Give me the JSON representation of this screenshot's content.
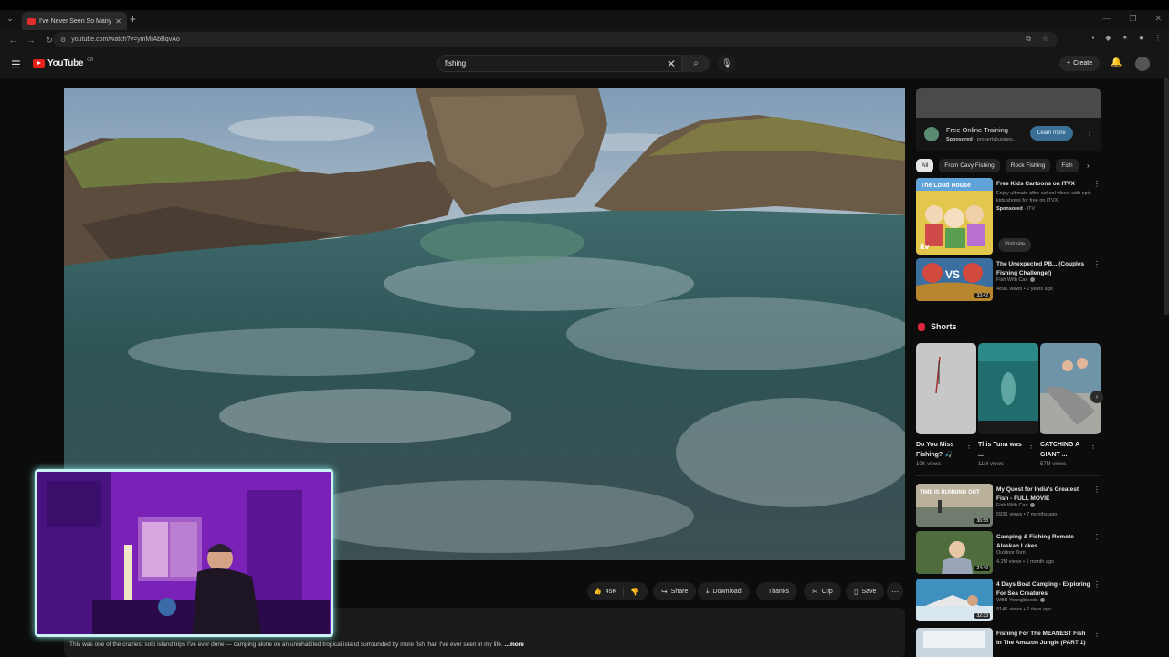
{
  "browser": {
    "tab_title": "I've Never Seen So Many F...",
    "url": "youtube.com/watch?v=ymMrAbBqvAo"
  },
  "youtube": {
    "logo": "YouTube",
    "country": "GB",
    "search_query": "fishing",
    "create_label": "Create"
  },
  "actions": {
    "likes": "45K",
    "share": "Share",
    "download": "Download",
    "thanks": "Thanks",
    "clip": "Clip",
    "save": "Save"
  },
  "description": {
    "text": "This was one of the craziest solo island trips I've ever done — camping alone on an uninhabited tropical island surrounded by more fish than I've ever seen in my life.",
    "more": "...more"
  },
  "sidebar": {
    "ad": {
      "title": "Free Online Training",
      "sponsored": "Sponsored",
      "domain": "· propertybusines...",
      "cta": "Learn more"
    },
    "chips": [
      "All",
      "From Cavy Fishing",
      "Rock Fishing",
      "Fish"
    ],
    "ad_video": {
      "thumb_text": "The Loud House",
      "thumb_brand": "itv",
      "title": "Free Kids Cartoons on ITVX",
      "desc": "Enjoy ultimate after-school vibes, with epic kids shows for free on ITVX.",
      "sponsored": "Sponsored",
      "advertiser": "· ITV",
      "cta": "Visit site"
    },
    "videos_top": [
      {
        "title": "The Unexpected PB... (Couples Fishing Challenge!)",
        "channel": "Fish With Carl",
        "meta": "489K views • 2 years ago",
        "duration": "33:42"
      }
    ],
    "shorts_label": "Shorts",
    "shorts": [
      {
        "title": "Do You Miss Fishing? 🎣",
        "views": "10K views"
      },
      {
        "title": "This Tuna was ...",
        "views": "11M views"
      },
      {
        "title": "CATCHING A GIANT ...",
        "views": "57M views"
      }
    ],
    "videos": [
      {
        "title": "My Quest for India's Greatest Fish - FULL MOVIE",
        "channel": "Fish With Carl",
        "meta": "593K views • 7 months ago",
        "duration": "36:58",
        "thumb_text": "TIME IS RUNNING OUT"
      },
      {
        "title": "Camping & Fishing Remote Alaskan Lakes",
        "channel": "Outdoor Tom",
        "meta": "4.2M views • 1 month ago",
        "duration": "24:40"
      },
      {
        "title": "4 Days Boat Camping - Exploring For Sea Creatures",
        "channel": "WBB Youngbloods",
        "meta": "914K views • 2 days ago",
        "duration": "32:33"
      },
      {
        "title": "Fishing For The MEANEST Fish In The Amazon Jungle (PART 1)",
        "channel": "",
        "meta": "",
        "duration": ""
      }
    ]
  }
}
